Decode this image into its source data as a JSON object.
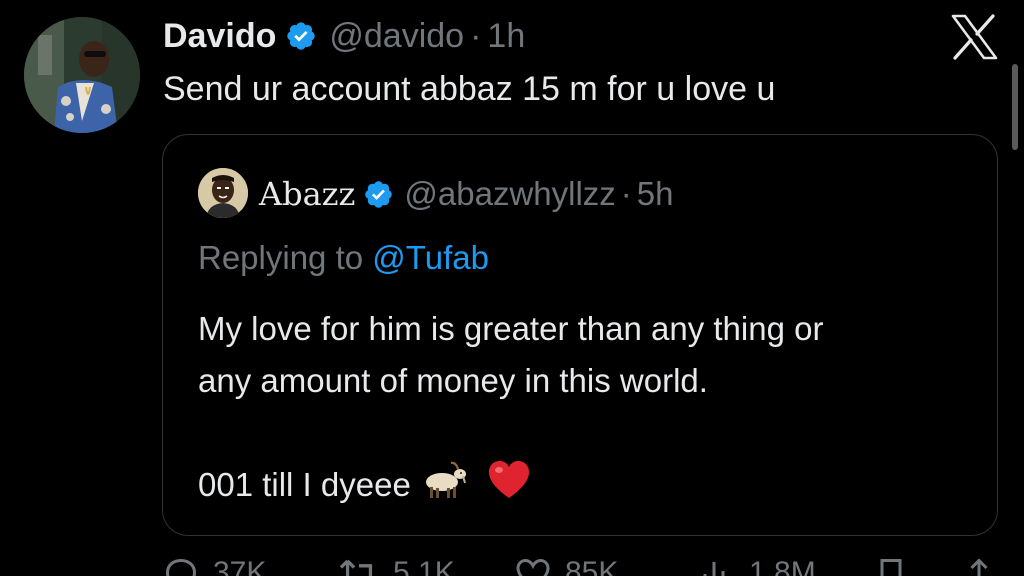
{
  "tweet": {
    "display_name": "Davido",
    "handle": "@davido",
    "separator": "·",
    "time": "1h",
    "text": "Send ur account abbaz 15 m for u love u",
    "verified_color": "#1d9bf0",
    "avatar_icon": "profile-photo"
  },
  "quote": {
    "display_name": "Abazz",
    "handle": "@abazwhyllzz",
    "separator": "·",
    "time": "5h",
    "replying_prefix": "Replying to",
    "replying_mention": "@Tufab",
    "body_line1": "My love for him is greater than any thing or",
    "body_line2": "any amount of money in this world.",
    "body_line3": "001 till I dyeee",
    "emojis": [
      "goat-emoji",
      "red-heart-emoji"
    ]
  },
  "actions": {
    "replies": "37K",
    "reposts": "5.1K",
    "likes": "85K",
    "views": "1.8M"
  },
  "brand": {
    "logo": "x-logo",
    "mention_color": "#1d9bf0",
    "muted_color": "#71767b",
    "text_color": "#e7e9ea"
  }
}
